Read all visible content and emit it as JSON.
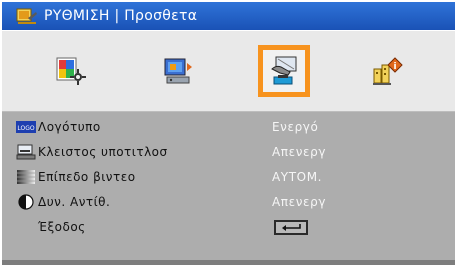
{
  "title": {
    "text": "ΡΥΘΜΙΣΗ | Προσθετα",
    "icon": "setup-menu-icon"
  },
  "tabs": [
    {
      "name": "picture",
      "icon": "picture-palette-icon",
      "selected": false
    },
    {
      "name": "display",
      "icon": "display-screen-icon",
      "selected": false
    },
    {
      "name": "setup",
      "icon": "setup-hand-icon",
      "selected": true
    },
    {
      "name": "info",
      "icon": "info-building-icon",
      "selected": false
    }
  ],
  "items": [
    {
      "label": "Λογότυπο",
      "value": "Ενεργό",
      "icon": "logo-icon"
    },
    {
      "label": "Κλειστος υποτιτλοσ",
      "value": "Απενεργ",
      "icon": "closed-caption-icon"
    },
    {
      "label": "Επίπεδο βιντεο",
      "value": "ΑΥΤΟΜ.",
      "icon": "video-level-icon"
    },
    {
      "label": "Δυν. Αντίθ.",
      "value": "Απενεργ",
      "icon": "dynamic-contrast-icon"
    },
    {
      "label": "Έξοδος",
      "value": "",
      "icon": "enter-key-icon"
    }
  ],
  "logo_badge": "LOGO",
  "colors": {
    "title_bar": "#2f73d8",
    "selected_border": "#f7931e",
    "body_bg": "#adadad",
    "value_text": "#f6f6f6"
  }
}
